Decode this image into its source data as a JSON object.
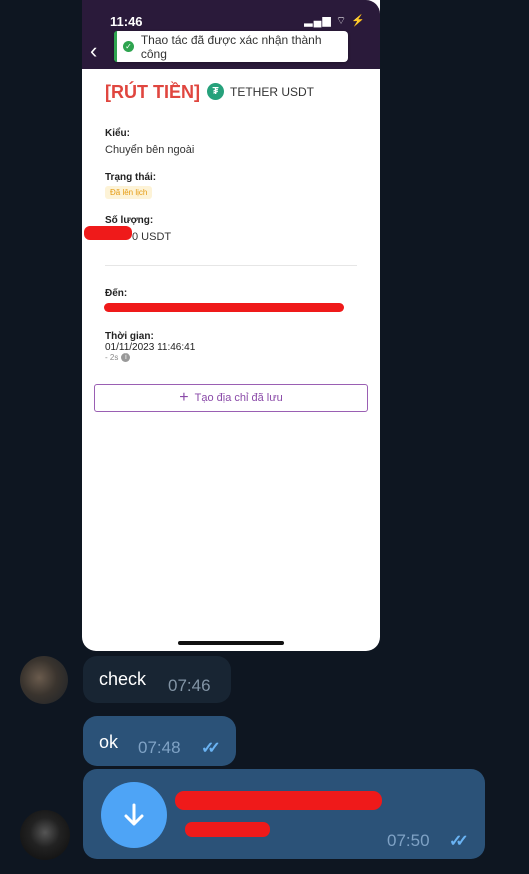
{
  "screenshot": {
    "status_time": "11:46",
    "status_icons": "▂▄▆ ⌔ ⚡",
    "back_icon": "chevron-left-icon",
    "toast": {
      "text": "Thao tác đã được xác nhận thành công",
      "color": "#2ea44f"
    },
    "title": "[RÚT TIỀN]",
    "coin": {
      "symbol": "₮",
      "name": "TETHER USDT",
      "color": "#26a17b"
    },
    "type_label": "Kiểu:",
    "type_value": "Chuyển bên ngoài",
    "status_label": "Trạng thái:",
    "status_value": "Đã lên lịch",
    "amount_label": "Số lượng:",
    "amount_value": "0 USDT",
    "to_label": "Đến:",
    "time_label": "Thời gian:",
    "time_value": "01/11/2023 11:46:41",
    "time_ago": "- 2s",
    "save_button": "Tạo địa chỉ đã lưu",
    "accent": "#e0463f"
  },
  "messages": [
    {
      "text": "check",
      "time": "07:46",
      "direction": "in"
    },
    {
      "text": "ok",
      "time": "07:48",
      "direction": "out"
    },
    {
      "time": "07:50",
      "direction": "out",
      "kind": "file"
    }
  ]
}
